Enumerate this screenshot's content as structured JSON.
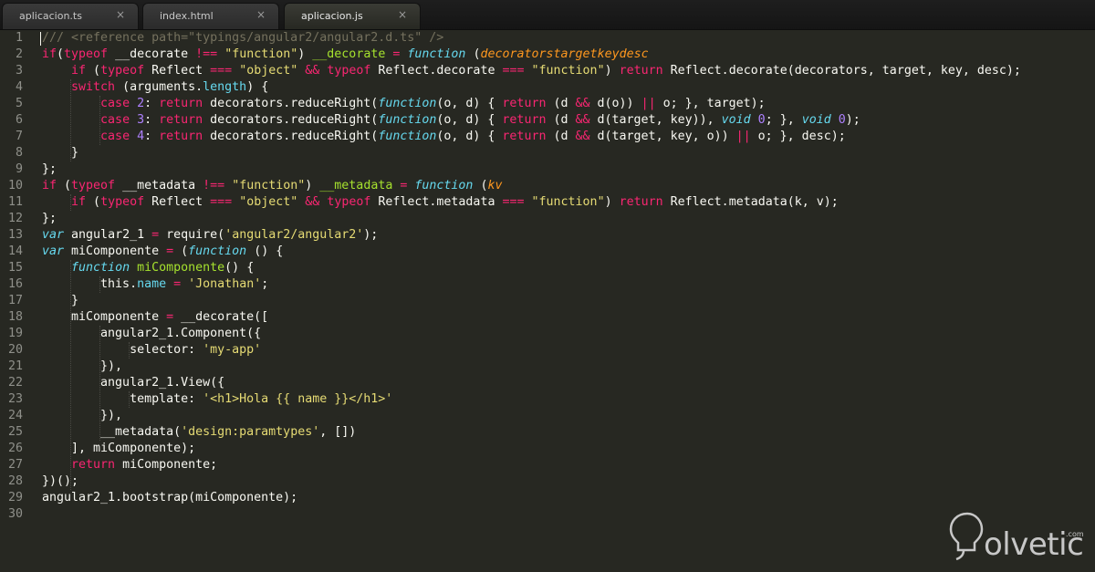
{
  "tabs": [
    {
      "label": "aplicacion.ts",
      "active": false,
      "close": "×"
    },
    {
      "label": "index.html",
      "active": false,
      "close": "×"
    },
    {
      "label": "aplicacion.js",
      "active": true,
      "close": "×"
    }
  ],
  "colors": {
    "background": "#272822",
    "keyword": "#f92672",
    "string": "#e6db74",
    "function_name": "#a6e22e",
    "comment": "#75715e",
    "number": "#ae81ff",
    "storage_type": "#66d9ef",
    "parameter": "#fd971f",
    "text": "#f8f8f2",
    "line_number": "#8f908a"
  },
  "code_lines": [
    [
      [
        "c",
        "/// <reference path=\"typings/angular2/angular2.d.ts\" />"
      ]
    ],
    [
      [
        "k",
        "if"
      ],
      [
        "",
        "("
      ],
      [
        "k",
        "typeof"
      ],
      [
        "",
        " __decorate "
      ],
      [
        "k",
        "!=="
      ],
      [
        "",
        " "
      ],
      [
        "s",
        "\"function\""
      ],
      [
        "",
        ") "
      ],
      [
        "f",
        "__decorate"
      ],
      [
        "",
        " "
      ],
      [
        "k",
        "="
      ],
      [
        "",
        " "
      ],
      [
        "st",
        "function"
      ],
      [
        "",
        " ("
      ],
      [
        "p",
        "decorators"
      ],
      [
        ", "
      ],
      [
        "p",
        "target"
      ],
      [
        ", "
      ],
      [
        "p",
        "key"
      ],
      [
        ", "
      ],
      [
        "p",
        "desc"
      ],
      [
        ") {"
      ]
    ],
    [
      [
        "",
        "    "
      ],
      [
        "k",
        "if"
      ],
      [
        "",
        " ("
      ],
      [
        "k",
        "typeof"
      ],
      [
        "",
        " Reflect "
      ],
      [
        "k",
        "==="
      ],
      [
        "",
        " "
      ],
      [
        "s",
        "\"object\""
      ],
      [
        "",
        " "
      ],
      [
        "k",
        "&&"
      ],
      [
        "",
        " "
      ],
      [
        "k",
        "typeof"
      ],
      [
        "",
        " Reflect.decorate "
      ],
      [
        "k",
        "==="
      ],
      [
        "",
        " "
      ],
      [
        "s",
        "\"function\""
      ],
      [
        "",
        ") "
      ],
      [
        "k",
        "return"
      ],
      [
        "",
        " Reflect.decorate(decorators, target, key, desc);"
      ]
    ],
    [
      [
        "",
        "    "
      ],
      [
        "k",
        "switch"
      ],
      [
        "",
        " (arguments."
      ],
      [
        "sp",
        "length"
      ],
      [
        "",
        ") {"
      ]
    ],
    [
      [
        "",
        "        "
      ],
      [
        "k",
        "case"
      ],
      [
        "",
        " "
      ],
      [
        "n",
        "2"
      ],
      [
        "",
        ": "
      ],
      [
        "k",
        "return"
      ],
      [
        "",
        " decorators.reduceRight("
      ],
      [
        "st",
        "function"
      ],
      [
        "",
        "(o, d) { "
      ],
      [
        "k",
        "return"
      ],
      [
        "",
        " (d "
      ],
      [
        "k",
        "&&"
      ],
      [
        "",
        " d(o)) "
      ],
      [
        "k",
        "||"
      ],
      [
        "",
        " o; }, target);"
      ]
    ],
    [
      [
        "",
        "        "
      ],
      [
        "k",
        "case"
      ],
      [
        "",
        " "
      ],
      [
        "n",
        "3"
      ],
      [
        "",
        ": "
      ],
      [
        "k",
        "return"
      ],
      [
        "",
        " decorators.reduceRight("
      ],
      [
        "st",
        "function"
      ],
      [
        "",
        "(o, d) { "
      ],
      [
        "k",
        "return"
      ],
      [
        "",
        " (d "
      ],
      [
        "k",
        "&&"
      ],
      [
        "",
        " d(target, key)), "
      ],
      [
        "st",
        "void"
      ],
      [
        "",
        " "
      ],
      [
        "n",
        "0"
      ],
      [
        "",
        "; }, "
      ],
      [
        "st",
        "void"
      ],
      [
        "",
        " "
      ],
      [
        "n",
        "0"
      ],
      [
        "",
        ");"
      ]
    ],
    [
      [
        "",
        "        "
      ],
      [
        "k",
        "case"
      ],
      [
        "",
        " "
      ],
      [
        "n",
        "4"
      ],
      [
        "",
        ": "
      ],
      [
        "k",
        "return"
      ],
      [
        "",
        " decorators.reduceRight("
      ],
      [
        "st",
        "function"
      ],
      [
        "",
        "(o, d) { "
      ],
      [
        "k",
        "return"
      ],
      [
        "",
        " (d "
      ],
      [
        "k",
        "&&"
      ],
      [
        "",
        " d(target, key, o)) "
      ],
      [
        "k",
        "||"
      ],
      [
        "",
        " o; }, desc);"
      ]
    ],
    [
      [
        "",
        "    }"
      ]
    ],
    [
      [
        "",
        "};"
      ]
    ],
    [
      [
        "k",
        "if"
      ],
      [
        "",
        " ("
      ],
      [
        "k",
        "typeof"
      ],
      [
        "",
        " __metadata "
      ],
      [
        "k",
        "!=="
      ],
      [
        "",
        " "
      ],
      [
        "s",
        "\"function\""
      ],
      [
        "",
        ") "
      ],
      [
        "f",
        "__metadata"
      ],
      [
        "",
        " "
      ],
      [
        "k",
        "="
      ],
      [
        "",
        " "
      ],
      [
        "st",
        "function"
      ],
      [
        "",
        " ("
      ],
      [
        "p",
        "k"
      ],
      [
        ", "
      ],
      [
        "p",
        "v"
      ],
      [
        ") {"
      ]
    ],
    [
      [
        "",
        "    "
      ],
      [
        "k",
        "if"
      ],
      [
        "",
        " ("
      ],
      [
        "k",
        "typeof"
      ],
      [
        "",
        " Reflect "
      ],
      [
        "k",
        "==="
      ],
      [
        "",
        " "
      ],
      [
        "s",
        "\"object\""
      ],
      [
        "",
        " "
      ],
      [
        "k",
        "&&"
      ],
      [
        "",
        " "
      ],
      [
        "k",
        "typeof"
      ],
      [
        "",
        " Reflect.metadata "
      ],
      [
        "k",
        "==="
      ],
      [
        "",
        " "
      ],
      [
        "s",
        "\"function\""
      ],
      [
        "",
        ") "
      ],
      [
        "k",
        "return"
      ],
      [
        "",
        " Reflect.metadata(k, v);"
      ]
    ],
    [
      [
        "",
        "};"
      ]
    ],
    [
      [
        "st",
        "var"
      ],
      [
        "",
        " angular2_1 "
      ],
      [
        "k",
        "="
      ],
      [
        "",
        " require("
      ],
      [
        "s",
        "'angular2/angular2'"
      ],
      [
        "",
        ");"
      ]
    ],
    [
      [
        "st",
        "var"
      ],
      [
        "",
        " miComponente "
      ],
      [
        "k",
        "="
      ],
      [
        "",
        " ("
      ],
      [
        "st",
        "function"
      ],
      [
        "",
        " () {"
      ]
    ],
    [
      [
        "",
        "    "
      ],
      [
        "st",
        "function"
      ],
      [
        "",
        " "
      ],
      [
        "f",
        "miComponente"
      ],
      [
        "",
        "() {"
      ]
    ],
    [
      [
        "",
        "        this."
      ],
      [
        "sp",
        "name"
      ],
      [
        "",
        " "
      ],
      [
        "k",
        "="
      ],
      [
        "",
        " "
      ],
      [
        "s",
        "'Jonathan'"
      ],
      [
        "",
        ";"
      ]
    ],
    [
      [
        "",
        "    }"
      ]
    ],
    [
      [
        "",
        "    miComponente "
      ],
      [
        "k",
        "="
      ],
      [
        "",
        " __decorate(["
      ]
    ],
    [
      [
        "",
        "        angular2_1.Component({"
      ]
    ],
    [
      [
        "",
        "            selector: "
      ],
      [
        "s",
        "'my-app'"
      ]
    ],
    [
      [
        "",
        "        }),"
      ]
    ],
    [
      [
        "",
        "        angular2_1.View({"
      ]
    ],
    [
      [
        "",
        "            template: "
      ],
      [
        "s",
        "'<h1>Hola {{ name }}</h1>'"
      ]
    ],
    [
      [
        "",
        "        }),"
      ]
    ],
    [
      [
        "",
        "        __metadata("
      ],
      [
        "s",
        "'design:paramtypes'"
      ],
      [
        "",
        ", [])"
      ]
    ],
    [
      [
        "",
        "    ], miComponente);"
      ]
    ],
    [
      [
        "",
        "    "
      ],
      [
        "k",
        "return"
      ],
      [
        "",
        " miComponente;"
      ]
    ],
    [
      [
        "",
        "})();"
      ]
    ],
    [
      [
        "",
        "angular2_1.bootstrap(miComponente);"
      ]
    ],
    [
      [
        "",
        ""
      ]
    ]
  ],
  "logo": {
    "text": "olvetic",
    "registered": ".com",
    "icon": "lightbulb-icon"
  }
}
